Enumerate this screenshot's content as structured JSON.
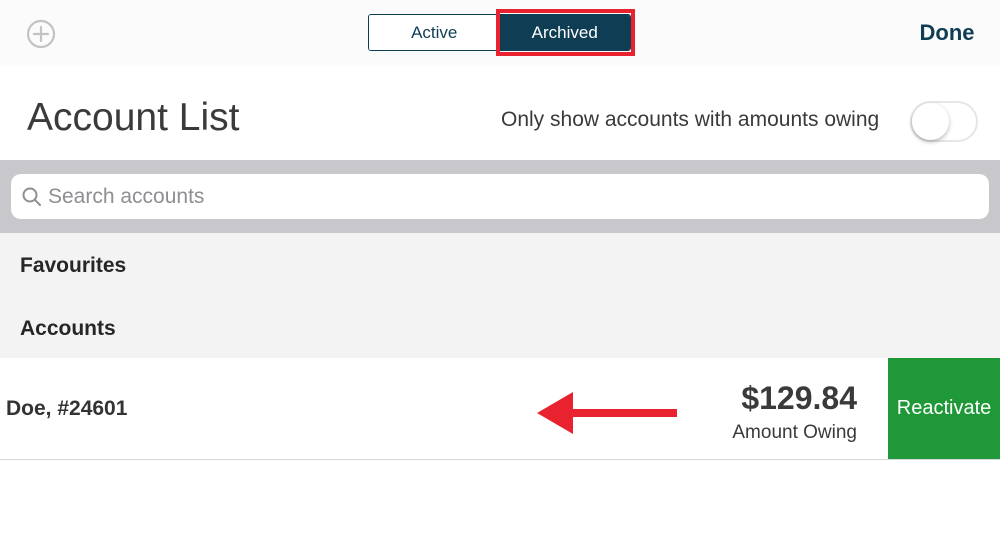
{
  "header": {
    "add_icon": "plus-circle-icon",
    "tabs": [
      {
        "label": "Active",
        "selected": false
      },
      {
        "label": "Archived",
        "selected": true
      }
    ],
    "done_label": "Done",
    "highlight_color": "#e8222f"
  },
  "title_row": {
    "title": "Account List",
    "filter_label": "Only show accounts with amounts owing",
    "filter_on": false
  },
  "search": {
    "icon": "search-icon",
    "placeholder": "Search accounts",
    "value": ""
  },
  "sections": {
    "favourites": "Favourites",
    "accounts": "Accounts"
  },
  "accounts": [
    {
      "name": "Doe, #24601",
      "amount": "$129.84",
      "amount_label": "Amount Owing",
      "action_label": "Reactivate"
    }
  ],
  "annotation": {
    "arrow_icon": "left-arrow-icon",
    "color": "#e8222f"
  },
  "colors": {
    "navy": "#0e3d54",
    "action_green": "#1f9838",
    "search_band": "#c8c7cc"
  }
}
